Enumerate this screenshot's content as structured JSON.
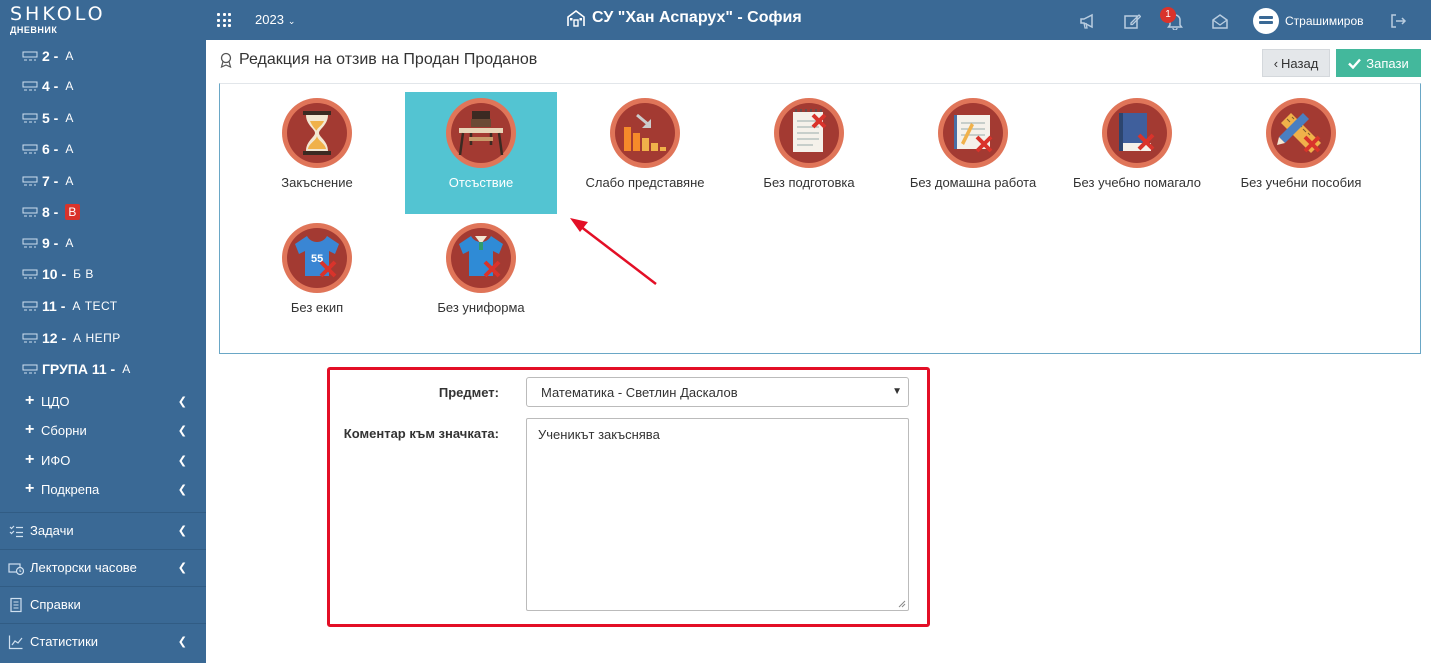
{
  "brand": {
    "word": "SHKOLO",
    "sub": "ДНЕВНИК"
  },
  "header": {
    "year": "2023",
    "school": "СУ \"Хан Аспарух\" - София",
    "notifications_count": "1",
    "user_name": "Страшимиров"
  },
  "sidebar": {
    "classes": [
      {
        "num": "2 -",
        "sub": "А"
      },
      {
        "num": "4 -",
        "sub": "А"
      },
      {
        "num": "5 -",
        "sub": "А"
      },
      {
        "num": "6 -",
        "sub": "А"
      },
      {
        "num": "7 -",
        "sub": "А"
      },
      {
        "num": "8 -",
        "sub": "В"
      },
      {
        "num": "9 -",
        "sub": "А"
      },
      {
        "num": "10 -",
        "sub": "Б  В"
      },
      {
        "num": "11 -",
        "sub": "А  ТЕСТ"
      },
      {
        "num": "12 -",
        "sub": "А  НЕПР"
      },
      {
        "num": "ГРУПА 11 -",
        "sub": "А"
      }
    ],
    "groups": [
      "ЦДО",
      "Сборни",
      "ИФО",
      "Подкрепа"
    ],
    "menu": [
      "Задачи",
      "Лекторски часове",
      "Справки",
      "Статистики"
    ]
  },
  "page": {
    "title": "Редакция на отзив на Продан Проданов",
    "back_label": "Назад",
    "save_label": "Запази"
  },
  "badges": [
    {
      "label": "Закъснение",
      "icon": "hourglass-icon",
      "selected": false
    },
    {
      "label": "Отсъствие",
      "icon": "empty-desk-icon",
      "selected": true
    },
    {
      "label": "Слабо представяне",
      "icon": "declining-chart-icon",
      "selected": false
    },
    {
      "label": "Без подготовка",
      "icon": "notepad-cross-icon",
      "selected": false
    },
    {
      "label": "Без домашна работа",
      "icon": "homework-cross-icon",
      "selected": false
    },
    {
      "label": "Без учебно помагало",
      "icon": "book-cross-icon",
      "selected": false
    },
    {
      "label": "Без учебни пособия",
      "icon": "ruler-pencil-cross-icon",
      "selected": false
    },
    {
      "label": "Без екип",
      "icon": "sports-shirt-cross-icon",
      "selected": false
    },
    {
      "label": "Без униформа",
      "icon": "uniform-cross-icon",
      "selected": false
    }
  ],
  "form": {
    "subject_label": "Предмет:",
    "subject_value": "Математика - Светлин Даскалов",
    "comment_label": "Коментар към значката:",
    "comment_value": "Ученикът закъснява"
  },
  "colors": {
    "header_bg": "#3a6995",
    "selected_badge_bg": "#53c4d2",
    "save_button": "#43b89c",
    "highlight_red": "#e30f26",
    "badge_circle": "#a33a32"
  }
}
